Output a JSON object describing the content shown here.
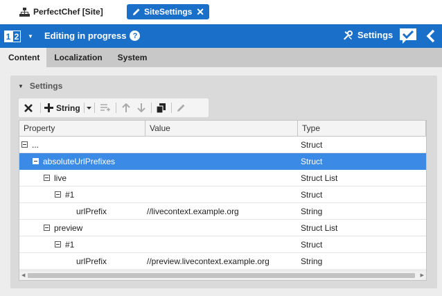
{
  "top_tabs": {
    "site_label": "PerfectChef [Site]",
    "active_label": "SiteSettings",
    "close_glyph": "✕"
  },
  "header": {
    "version_a": "1",
    "version_b": "2",
    "caret": "▼",
    "status": "Editing in progress",
    "help": "?",
    "settings_label": "Settings"
  },
  "subtabs": [
    "Content",
    "Localization",
    "System"
  ],
  "panel": {
    "title": "Settings",
    "collapse_glyph": "▼"
  },
  "toolbar": {
    "string_label": "String",
    "icons": [
      "delete-icon",
      "add-icon",
      "dropdown-caret-icon",
      "add-entry-icon",
      "move-up-icon",
      "move-down-icon",
      "copy-icon",
      "edit-icon"
    ]
  },
  "table": {
    "headers": [
      "Property",
      "Value",
      "Type"
    ],
    "rows": [
      {
        "property": "...",
        "value": "",
        "type": "Struct",
        "toggle": true,
        "selected": false
      },
      {
        "property": "absoluteUrlPrefixes",
        "value": "",
        "type": "Struct",
        "toggle": true,
        "selected": true
      },
      {
        "property": "live",
        "value": "",
        "type": "Struct List",
        "toggle": true,
        "selected": false
      },
      {
        "property": "#1",
        "value": "",
        "type": "Struct",
        "toggle": true,
        "selected": false
      },
      {
        "property": "urlPrefix",
        "value": "//livecontext.example.org",
        "type": "String",
        "toggle": false,
        "selected": false
      },
      {
        "property": "preview",
        "value": "",
        "type": "Struct List",
        "toggle": true,
        "selected": false
      },
      {
        "property": "#1",
        "value": "",
        "type": "Struct",
        "toggle": true,
        "selected": false
      },
      {
        "property": "urlPrefix",
        "value": "//preview.livecontext.example.org",
        "type": "String",
        "toggle": false,
        "selected": false
      }
    ]
  },
  "colors": {
    "brand_blue": "#1a6fc9",
    "selection_blue": "#3a8ae6",
    "subtab_bar": "#c8c8c8",
    "content_bg": "#ededed"
  }
}
